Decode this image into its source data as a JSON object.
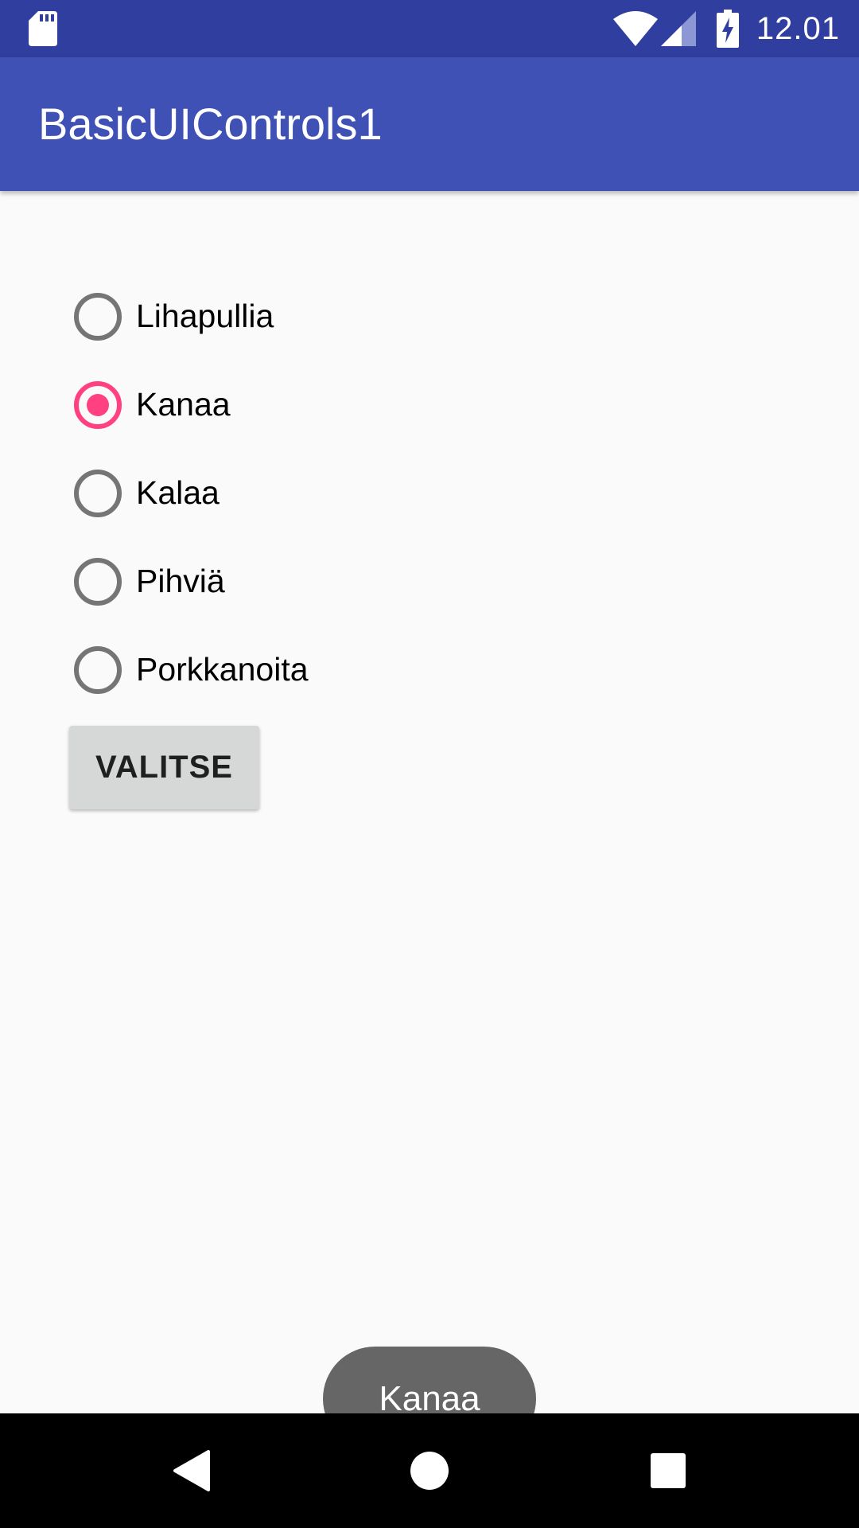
{
  "status_bar": {
    "time": "12.01",
    "icons": [
      "sd-card-icon",
      "wifi-icon",
      "cell-signal-icon",
      "battery-charging-icon"
    ]
  },
  "app_bar": {
    "title": "BasicUIControls1"
  },
  "radio_group": {
    "options": [
      {
        "label": "Lihapullia",
        "checked": false
      },
      {
        "label": "Kanaa",
        "checked": true
      },
      {
        "label": "Kalaa",
        "checked": false
      },
      {
        "label": "Pihviä",
        "checked": false
      },
      {
        "label": "Porkkanoita",
        "checked": false
      }
    ]
  },
  "button": {
    "label": "VALITSE"
  },
  "toast": {
    "text": "Kanaa"
  },
  "nav_bar": {
    "icons": [
      "back-icon",
      "home-icon",
      "recents-icon"
    ]
  },
  "colors": {
    "status_bar": "#303f9f",
    "app_bar": "#3f51b5",
    "accent": "#ff4081",
    "background": "#fafafa",
    "radio_unchecked": "#757575",
    "button": "#d6d7d7",
    "toast": "#666666",
    "nav_bar": "#000000"
  }
}
